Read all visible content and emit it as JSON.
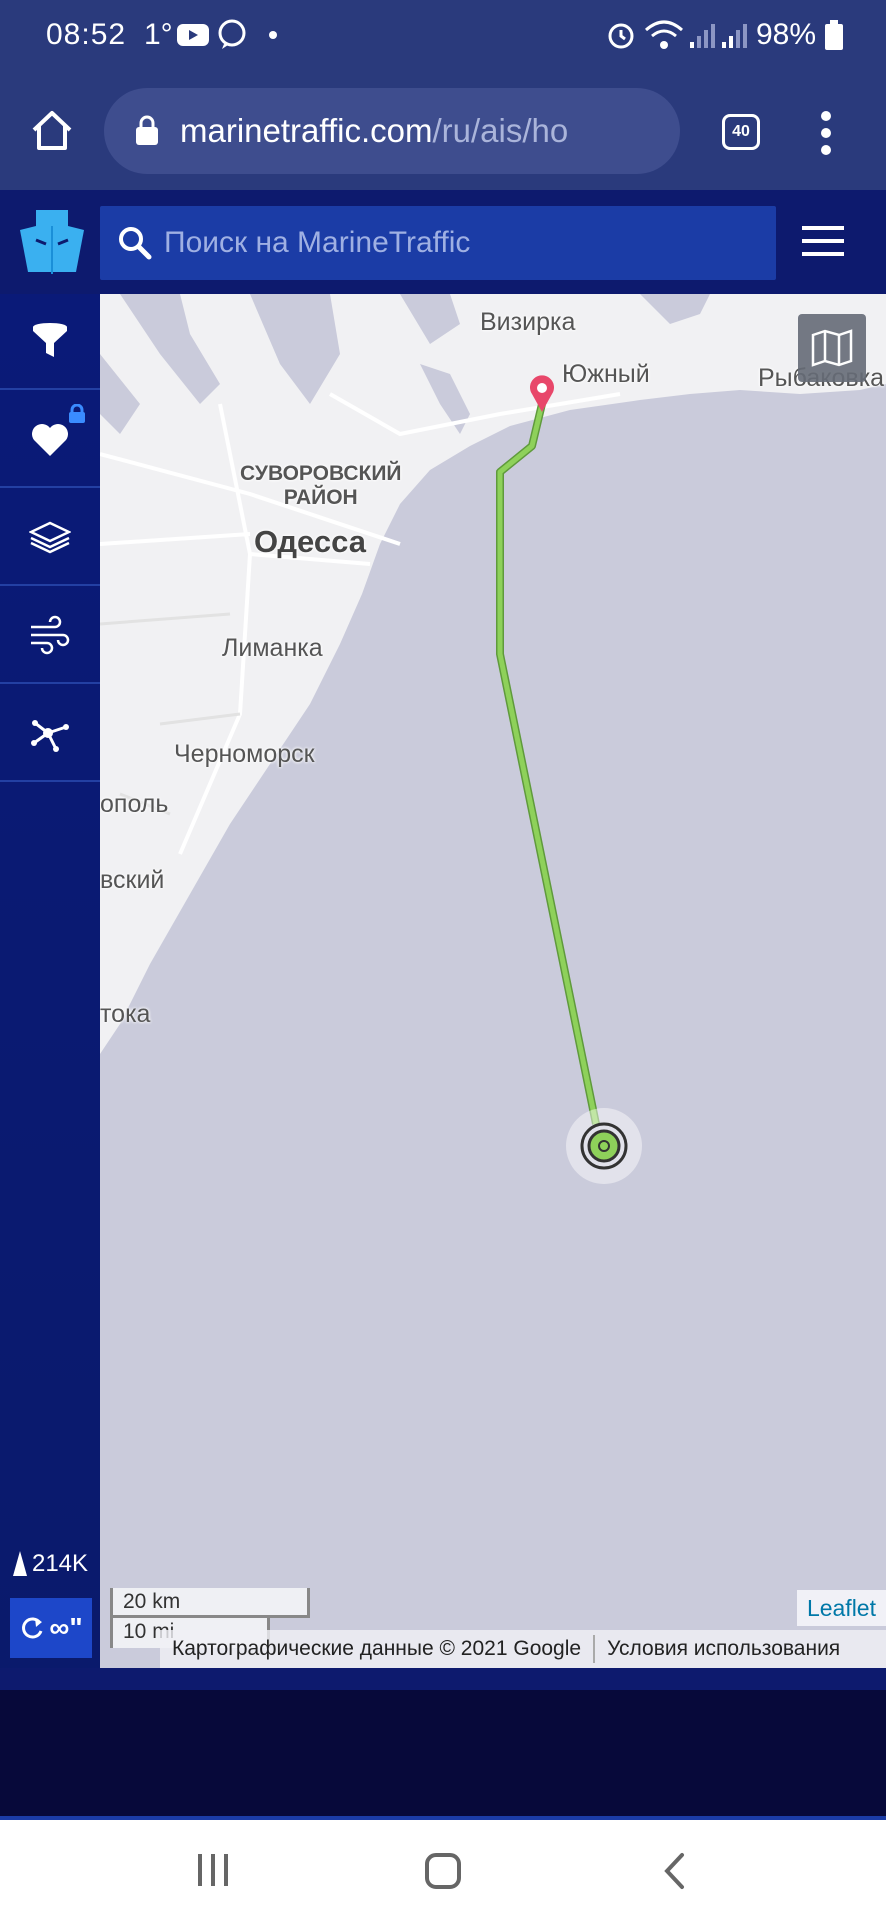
{
  "status_bar": {
    "time": "08:52",
    "temperature": "1°",
    "battery": "98%"
  },
  "browser": {
    "url_domain": "marinetraffic.com",
    "url_path": "/ru/ais/ho",
    "tab_count": "40"
  },
  "header": {
    "search_placeholder": "Поиск на MarineTraffic"
  },
  "sidebar": {
    "items": [
      {
        "icon": "filter-icon"
      },
      {
        "icon": "heart-icon",
        "locked": true
      },
      {
        "icon": "layers-icon"
      },
      {
        "icon": "wind-icon"
      },
      {
        "icon": "network-icon"
      }
    ],
    "vessel_count": "214K",
    "refresh_label": "∞\""
  },
  "map": {
    "labels": {
      "vizirka": "Визирка",
      "yuzhny": "Южный",
      "rybakovka": "Рыбаковка",
      "suvorovsky": "СУВОРОВСКИЙ",
      "rayon": "РАЙОН",
      "odessa": "Одесса",
      "limanka": "Лиманка",
      "chernomorsk": "Черноморск",
      "opol": "ополь",
      "vsky": "вский",
      "toka": "тока"
    },
    "scale_km": "20 km",
    "scale_mi": "10 mi",
    "attribution": "Картографические данные © 2021 Google",
    "terms": "Условия использования",
    "leaflet": "Leaflet",
    "track_color": "#8ed15a",
    "land_color": "#f2f2f2",
    "water_color": "#cacbdb"
  }
}
